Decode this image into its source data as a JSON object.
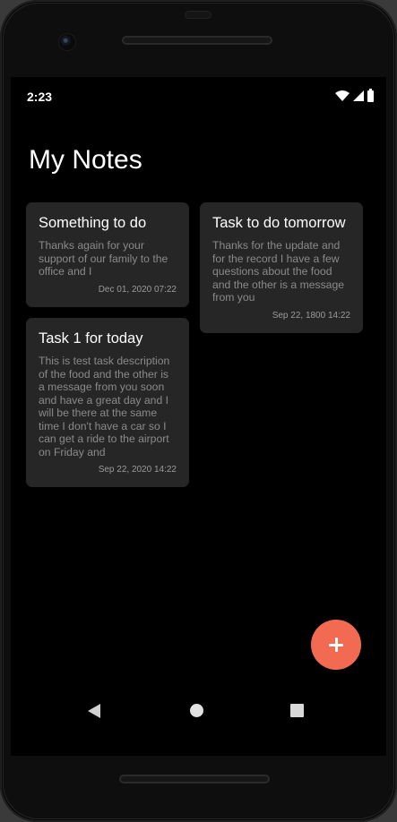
{
  "status_bar": {
    "time": "2:23"
  },
  "app": {
    "title": "My Notes"
  },
  "notes": [
    {
      "title": "Something to do",
      "body": "Thanks again for your support of our family to the office and I",
      "date": "Dec 01, 2020 07:22"
    },
    {
      "title": "Task to do tomorrow",
      "body": "Thanks for the update and for the record I have a few questions about the food and the other is a message from you",
      "date": "Sep 22, 1800 14:22"
    },
    {
      "title": "Task 1 for today",
      "body": "This is test task description of the food and the other is a message from you soon and have a great day and I will be there at the same time I don't have a car so I can get a ride to the airport on Friday and",
      "date": "Sep 22, 2020 14:22"
    }
  ],
  "fab": {
    "icon": "plus-icon"
  },
  "nav": {
    "back_icon": "back-triangle-icon",
    "home_icon": "home-circle-icon",
    "recents_icon": "recents-square-icon"
  },
  "colors": {
    "background": "#000000",
    "card": "#262626",
    "accent": "#f26a51",
    "title_text": "#ffffff",
    "body_text": "#8a8a8a"
  }
}
